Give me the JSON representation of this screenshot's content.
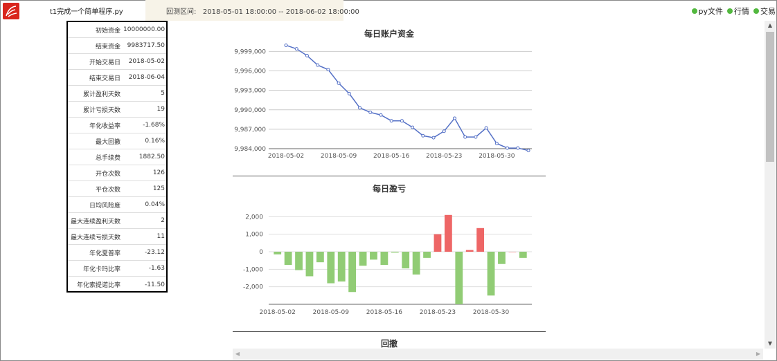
{
  "header": {
    "file_tab": "t1完成一个简单程序.py",
    "range_label": "回测区间:",
    "range_value": "2018-05-01 18:00:00 -- 2018-06-02 18:00:00",
    "links": [
      {
        "label": "py文件",
        "icon": "green-dot-icon"
      },
      {
        "label": "行情",
        "icon": "green-dot-icon"
      },
      {
        "label": "交易",
        "icon": "green-dot-icon"
      }
    ]
  },
  "stats": [
    {
      "label": "初始资金",
      "value": "10000000.00"
    },
    {
      "label": "结束资金",
      "value": "9983717.50"
    },
    {
      "label": "开始交易日",
      "value": "2018-05-02"
    },
    {
      "label": "结束交易日",
      "value": "2018-06-04"
    },
    {
      "label": "累计盈利天数",
      "value": "5"
    },
    {
      "label": "累计亏损天数",
      "value": "19"
    },
    {
      "label": "年化收益率",
      "value": "-1.68%"
    },
    {
      "label": "最大回撤",
      "value": "0.16%"
    },
    {
      "label": "总手续费",
      "value": "1882.50"
    },
    {
      "label": "开仓次数",
      "value": "126"
    },
    {
      "label": "平仓次数",
      "value": "125"
    },
    {
      "label": "日均风险度",
      "value": "0.04%"
    },
    {
      "label": "最大连续盈利天数",
      "value": "2"
    },
    {
      "label": "最大连续亏损天数",
      "value": "11"
    },
    {
      "label": "年化夏普率",
      "value": "-23.12"
    },
    {
      "label": "年化卡玛比率",
      "value": "-1.63"
    },
    {
      "label": "年化索提诺比率",
      "value": "-11.50"
    }
  ],
  "colors": {
    "line": "#5470c6",
    "profit": "#ee6666",
    "loss": "#91cc75",
    "brand": "#d9251c",
    "link_dot": "#53b83f"
  },
  "chart_data": [
    {
      "type": "line",
      "title": "每日账户资金",
      "x": [
        "2018-05-02",
        "2018-05-03",
        "2018-05-04",
        "2018-05-07",
        "2018-05-08",
        "2018-05-09",
        "2018-05-10",
        "2018-05-11",
        "2018-05-14",
        "2018-05-15",
        "2018-05-16",
        "2018-05-17",
        "2018-05-18",
        "2018-05-21",
        "2018-05-22",
        "2018-05-23",
        "2018-05-24",
        "2018-05-25",
        "2018-05-28",
        "2018-05-29",
        "2018-05-30",
        "2018-05-31",
        "2018-06-01",
        "2018-06-04"
      ],
      "values": [
        9999950,
        9999400,
        9998350,
        9996900,
        9996200,
        9994100,
        9992500,
        9990300,
        9989600,
        9989200,
        9988300,
        9988300,
        9987300,
        9986000,
        9985700,
        9986700,
        9988700,
        9985800,
        9985800,
        9987200,
        9984800,
        9984100,
        9984100,
        9983717.5
      ],
      "x_ticks": [
        "2018-05-02",
        "2018-05-09",
        "2018-05-16",
        "2018-05-23",
        "2018-05-30"
      ],
      "y_ticks": [
        "9,984,000",
        "9,987,000",
        "9,990,000",
        "9,993,000",
        "9,996,000",
        "9,999,000"
      ],
      "ylim": [
        9984000,
        10000000
      ]
    },
    {
      "type": "bar",
      "title": "每日盈亏",
      "x": [
        "2018-05-02",
        "2018-05-03",
        "2018-05-04",
        "2018-05-07",
        "2018-05-08",
        "2018-05-09",
        "2018-05-10",
        "2018-05-11",
        "2018-05-14",
        "2018-05-15",
        "2018-05-16",
        "2018-05-17",
        "2018-05-18",
        "2018-05-21",
        "2018-05-22",
        "2018-05-23",
        "2018-05-24",
        "2018-05-25",
        "2018-05-28",
        "2018-05-29",
        "2018-05-30",
        "2018-05-31",
        "2018-06-01",
        "2018-06-04"
      ],
      "values": [
        -150,
        -750,
        -1050,
        -1400,
        -600,
        -1800,
        -1700,
        -2300,
        -800,
        -450,
        -750,
        -50,
        -950,
        -1300,
        -350,
        1000,
        2100,
        -3000,
        100,
        1350,
        -2500,
        -700,
        0,
        -350
      ],
      "x_ticks": [
        "2018-05-02",
        "2018-05-09",
        "2018-05-16",
        "2018-05-23",
        "2018-05-30"
      ],
      "y_ticks": [
        "-2,000",
        "-1,000",
        "0",
        "1,000",
        "2,000"
      ],
      "ylim": [
        -3000,
        3000
      ]
    },
    {
      "type": "line",
      "title": "回撤"
    }
  ]
}
